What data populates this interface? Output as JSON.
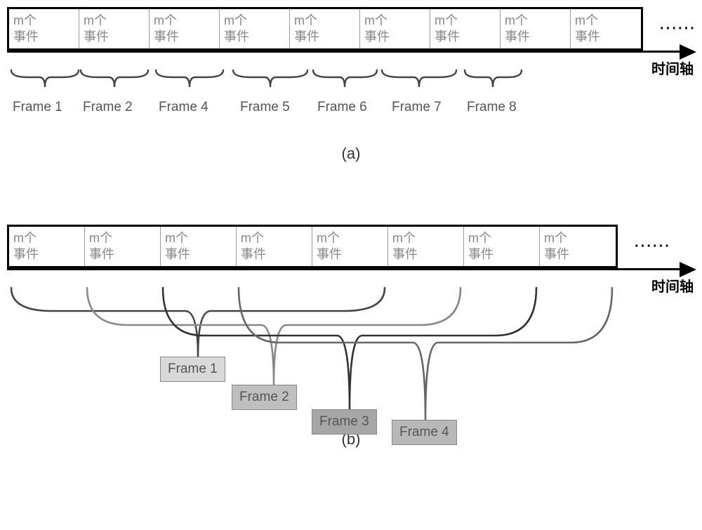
{
  "cell_text_line1": "m个",
  "cell_text_line2": "事件",
  "ellipsis": "······",
  "axis_label": "时间轴",
  "diagram_a": {
    "frames": [
      {
        "label": "Frame 1"
      },
      {
        "label": "Frame 2"
      },
      {
        "label": "Frame 4"
      },
      {
        "label": "Frame 5"
      },
      {
        "label": "Frame 6"
      },
      {
        "label": "Frame 7"
      },
      {
        "label": "Frame 8"
      }
    ],
    "sublabel": "(a)"
  },
  "diagram_b": {
    "frames": [
      {
        "label": "Frame 1",
        "color": "#d9d9d9"
      },
      {
        "label": "Frame 2",
        "color": "#bfbfbf"
      },
      {
        "label": "Frame 3",
        "color": "#a6a6a6"
      },
      {
        "label": "Frame 4",
        "color": "#b8b8b8"
      }
    ],
    "sublabel": "(b)",
    "window_cells": 5,
    "step_cells": 1
  }
}
